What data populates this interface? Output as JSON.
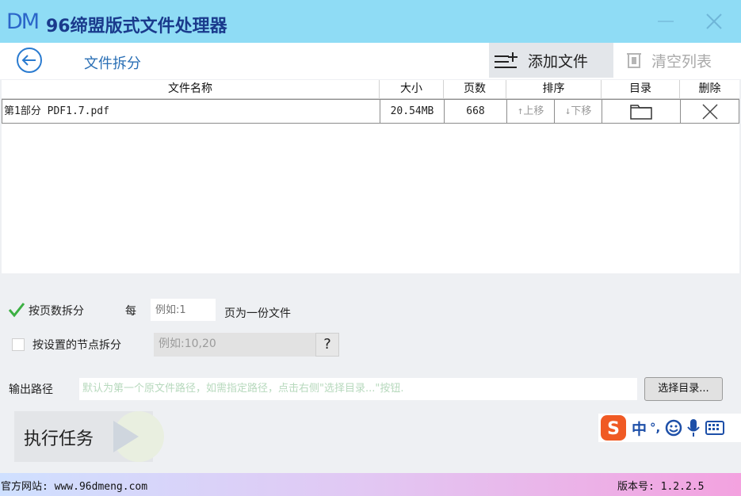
{
  "app": {
    "logo": "DM",
    "title": "96缔盟版式文件处理器"
  },
  "toolbar": {
    "section_title": "文件拆分",
    "add_file_label": "添加文件",
    "clear_list_label": "清空列表"
  },
  "table": {
    "headers": {
      "name": "文件名称",
      "size": "大小",
      "pages": "页数",
      "order": "排序",
      "directory": "目录",
      "delete": "删除"
    },
    "rows": [
      {
        "name": "第1部分 PDF1.7.pdf",
        "size": "20.54MB",
        "pages": "668",
        "move_up": "↑上移",
        "move_down": "↓下移"
      }
    ]
  },
  "options": {
    "split_by_pages_label": "按页数拆分",
    "every_label": "每",
    "pages_placeholder": "例如:1",
    "pages_suffix": "页为一份文件",
    "split_by_nodes_label": "按设置的节点拆分",
    "nodes_placeholder": "例如:10,20",
    "help_label": "?"
  },
  "output": {
    "label": "输出路径",
    "placeholder": "默认为第一个原文件路径，如需指定路径，点击右侧\"选择目录...\"按钮.",
    "browse_label": "选择目录..."
  },
  "run": {
    "label": "执行任务"
  },
  "ime": {
    "mode": "中",
    "punct": "°,"
  },
  "footer": {
    "site": "官方网站:  www.96dmeng.com",
    "version": "版本号: 1.2.2.5"
  },
  "colors": {
    "titlebar": "#8fdcf5",
    "accent": "#2a6fb5",
    "check": "#3cb043"
  }
}
